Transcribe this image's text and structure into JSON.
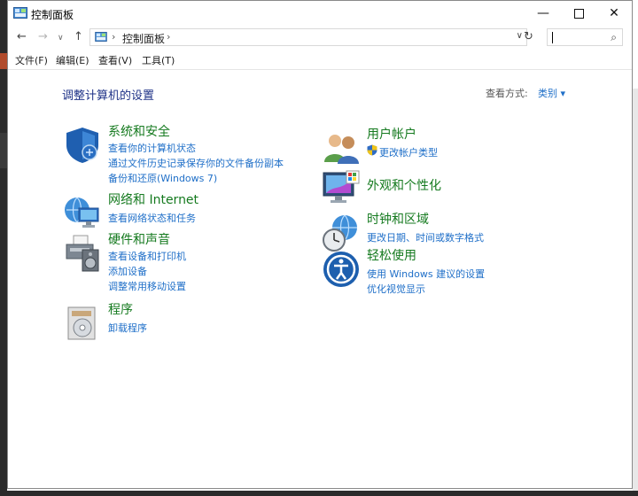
{
  "window": {
    "title": "控制面板",
    "controls": {
      "minimize": "—",
      "close": "✕"
    }
  },
  "address": {
    "path": "控制面板",
    "separator": "›",
    "back": "←",
    "forward": "→",
    "recent": "∨",
    "up": "↑",
    "dropdown": "∨",
    "refresh": "↻",
    "search_placeholder": ""
  },
  "menu": [
    "文件(F)",
    "编辑(E)",
    "查看(V)",
    "工具(T)"
  ],
  "header": {
    "title": "调整计算机的设置",
    "view_by_label": "查看方式:",
    "view_by_value": "类别 ▾"
  },
  "categories_left": [
    {
      "name": "系统和安全",
      "links": [
        "查看你的计算机状态",
        "通过文件历史记录保存你的文件备份副本",
        "备份和还原(Windows 7)"
      ]
    },
    {
      "name": "网络和 Internet",
      "links": [
        "查看网络状态和任务"
      ]
    },
    {
      "name": "硬件和声音",
      "links": [
        "查看设备和打印机",
        "添加设备",
        "调整常用移动设置"
      ]
    },
    {
      "name": "程序",
      "links": [
        "卸载程序"
      ]
    }
  ],
  "categories_right": [
    {
      "name": "用户帐户",
      "links": [
        "更改帐户类型"
      ]
    },
    {
      "name": "外观和个性化",
      "links": []
    },
    {
      "name": "时钟和区域",
      "links": [
        "更改日期、时间或数字格式"
      ]
    },
    {
      "name": "轻松使用",
      "links": [
        "使用 Windows 建议的设置",
        "优化视觉显示"
      ]
    }
  ]
}
